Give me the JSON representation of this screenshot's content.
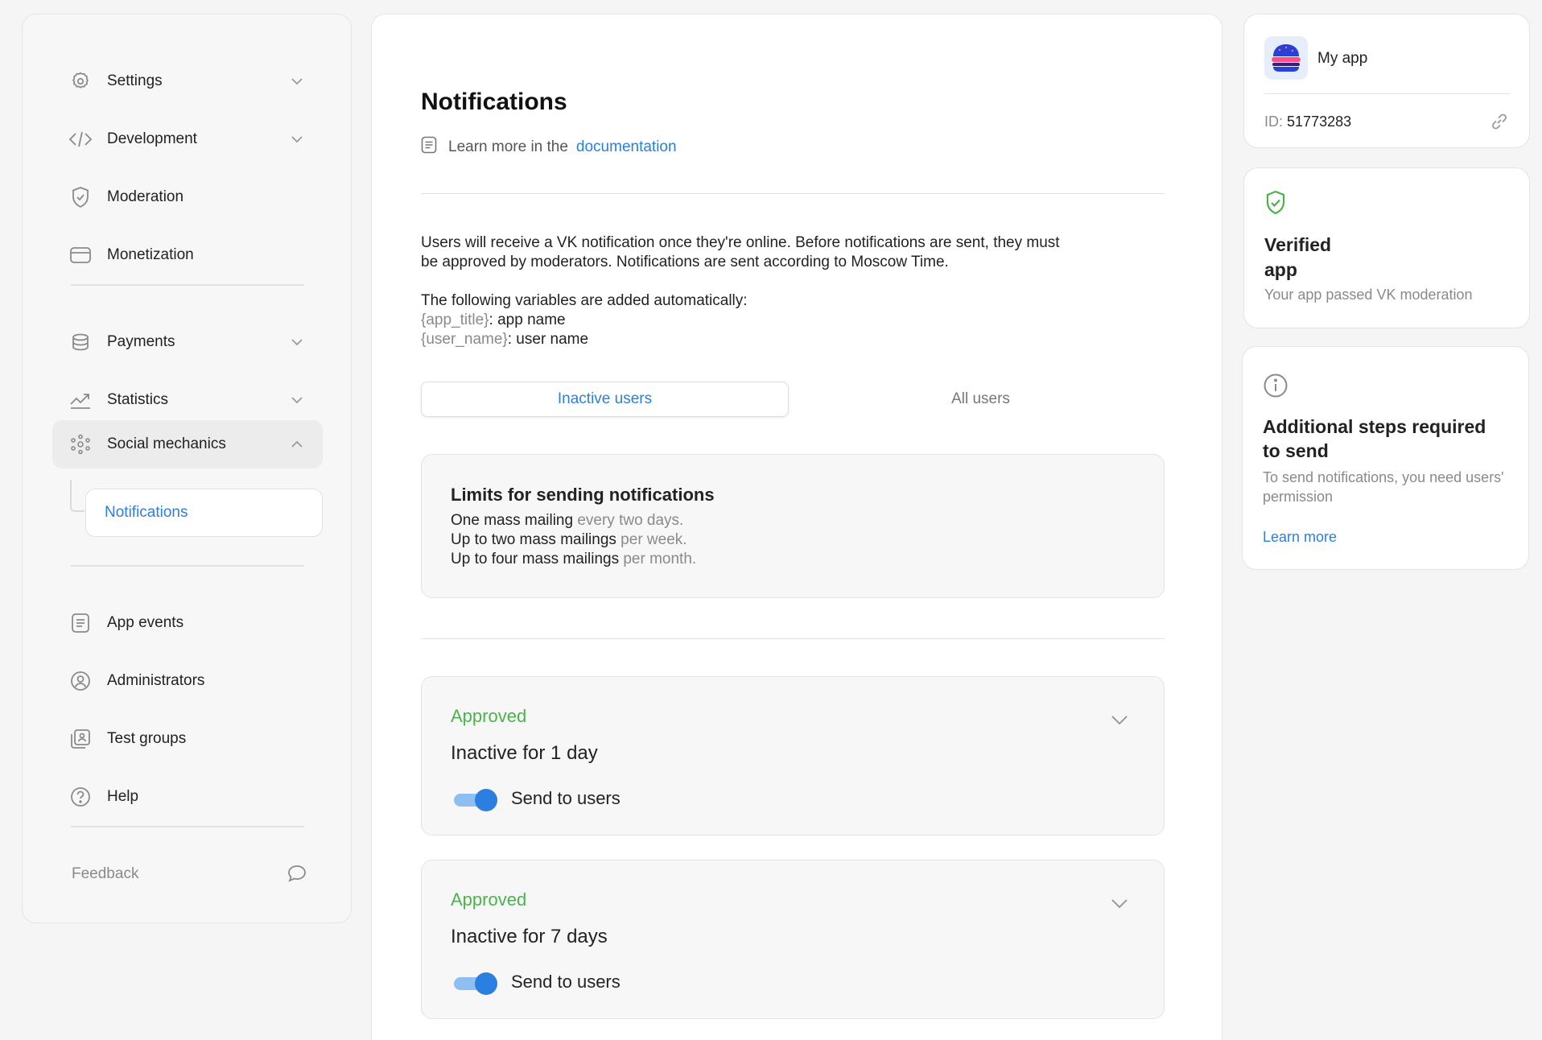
{
  "sidebar": {
    "items": [
      {
        "label": "Settings",
        "icon": "gear-icon"
      },
      {
        "label": "Development",
        "icon": "code-icon"
      },
      {
        "label": "Moderation",
        "icon": "shield-icon"
      },
      {
        "label": "Monetization",
        "icon": "card-icon"
      },
      {
        "label": "Payments",
        "icon": "coins-icon"
      },
      {
        "label": "Statistics",
        "icon": "trend-icon"
      },
      {
        "label": "Social mechanics",
        "icon": "dots-icon"
      },
      {
        "label": "App events",
        "icon": "list-icon"
      },
      {
        "label": "Administrators",
        "icon": "user-circle-icon"
      },
      {
        "label": "Test groups",
        "icon": "group-icon"
      },
      {
        "label": "Help",
        "icon": "help-icon"
      }
    ],
    "sub_item": "Notifications",
    "feedback": "Feedback"
  },
  "main": {
    "title": "Notifications",
    "doc_prefix": "Learn more in the",
    "doc_link": "documentation",
    "desc_line1": "Users will receive a VK notification once they're online. Before notifications are sent, they must",
    "desc_line2": "be approved by moderators. Notifications are sent according to Moscow Time.",
    "vars_intro": "The following variables are added automatically:",
    "var1_key": "{app_title}",
    "var1_val": ": app name",
    "var2_key": "{user_name}",
    "var2_val": ": user name",
    "tabs": {
      "active": "Inactive users",
      "inactive": "All users"
    },
    "limits": {
      "title": "Limits for sending notifications",
      "lines": [
        {
          "main": "One mass mailing",
          "muted": " every two days."
        },
        {
          "main": "Up to two mass mailings",
          "muted": " per week."
        },
        {
          "main": "Up to four mass mailings",
          "muted": " per month."
        }
      ]
    },
    "cards": [
      {
        "status": "Approved",
        "title": "Inactive for 1 day",
        "toggle_label": "Send to users",
        "toggle_on": true
      },
      {
        "status": "Approved",
        "title": "Inactive for 7 days",
        "toggle_label": "Send to users",
        "toggle_on": true
      }
    ]
  },
  "right": {
    "app": {
      "name": "My app",
      "id_label": "ID:",
      "id_value": "51773283"
    },
    "verified": {
      "title": "Verified app",
      "subtitle": "Your app passed VK moderation"
    },
    "steps": {
      "title": "Additional steps required to send",
      "subtitle": "To send notifications, you need users' permission",
      "link": "Learn more"
    }
  },
  "colors": {
    "accent": "#2b7fe0",
    "success": "#4bb34b",
    "muted": "#8a8a8a"
  }
}
